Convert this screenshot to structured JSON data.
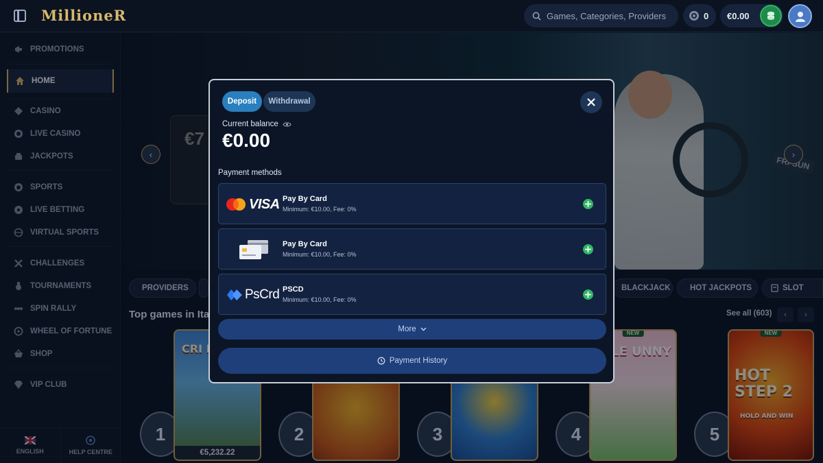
{
  "header": {
    "logo": "MillioneR",
    "search_placeholder": "Games, Categories, Providers",
    "bonus_count": "0",
    "balance": "€0.00"
  },
  "sidebar": {
    "items": [
      {
        "label": "PROMOTIONS",
        "icon": "megaphone-icon"
      },
      {
        "label": "HOME",
        "icon": "home-icon"
      },
      {
        "label": "CASINO",
        "icon": "diamond-icon"
      },
      {
        "label": "LIVE CASINO",
        "icon": "chip-icon"
      },
      {
        "label": "JACKPOTS",
        "icon": "coins-icon"
      },
      {
        "label": "SPORTS",
        "icon": "football-icon"
      },
      {
        "label": "LIVE BETTING",
        "icon": "live-icon"
      },
      {
        "label": "VIRTUAL SPORTS",
        "icon": "globe-icon"
      },
      {
        "label": "CHALLENGES",
        "icon": "swords-icon"
      },
      {
        "label": "TOURNAMENTS",
        "icon": "medal-icon"
      },
      {
        "label": "SPIN RALLY",
        "icon": "rally-icon"
      },
      {
        "label": "WHEEL OF FORTUNE",
        "icon": "wheel-icon"
      },
      {
        "label": "SHOP",
        "icon": "basket-icon"
      },
      {
        "label": "VIP CLUB",
        "icon": "gem-icon"
      }
    ],
    "language": "ENGLISH",
    "help": "HELP CENTRE"
  },
  "hero": {
    "card_text": "€7",
    "badge": "FRI-SUN"
  },
  "categories": [
    "PROVIDERS",
    "BLACKJACK",
    "HOT JACKPOTS",
    "SLOT"
  ],
  "top_games": {
    "title": "Top games in Ita",
    "see_all": "See all (603)",
    "games": [
      {
        "rank": "1",
        "title": "CRI PIGG",
        "price": "€5,232.22",
        "new": ""
      },
      {
        "rank": "2",
        "title": "",
        "price": "",
        "new": ""
      },
      {
        "rank": "3",
        "title": "",
        "price": "",
        "new": ""
      },
      {
        "rank": "4",
        "title": "LE UNNY",
        "price": "",
        "new": "NEW"
      },
      {
        "rank": "5",
        "title": "HOT STEP 2",
        "subtitle": "HOLD AND WIN",
        "price": "",
        "new": "NEW"
      }
    ]
  },
  "modal": {
    "tabs": {
      "deposit": "Deposit",
      "withdrawal": "Withdrawal"
    },
    "balance_label": "Current balance",
    "balance_value": "€0.00",
    "payment_methods_label": "Payment methods",
    "methods": [
      {
        "name": "Pay By Card",
        "logo": "VISA",
        "minimum": "Minimum: €10.00,",
        "fee": "Fee: 0%"
      },
      {
        "name": "Pay By Card",
        "logo": "",
        "minimum": "Minimum: €10.00,",
        "fee": "Fee: 0%"
      },
      {
        "name": "PSCD",
        "logo": "PsCrd",
        "minimum": "Minimum: €10.00,",
        "fee": "Fee: 0%"
      }
    ],
    "more": "More",
    "history": "Payment History"
  },
  "colors": {
    "accent_gold": "#d8b86a",
    "deposit_tab": "#2a7fbf",
    "add_green": "#2fb565",
    "button_blue": "#1e3f7a"
  }
}
